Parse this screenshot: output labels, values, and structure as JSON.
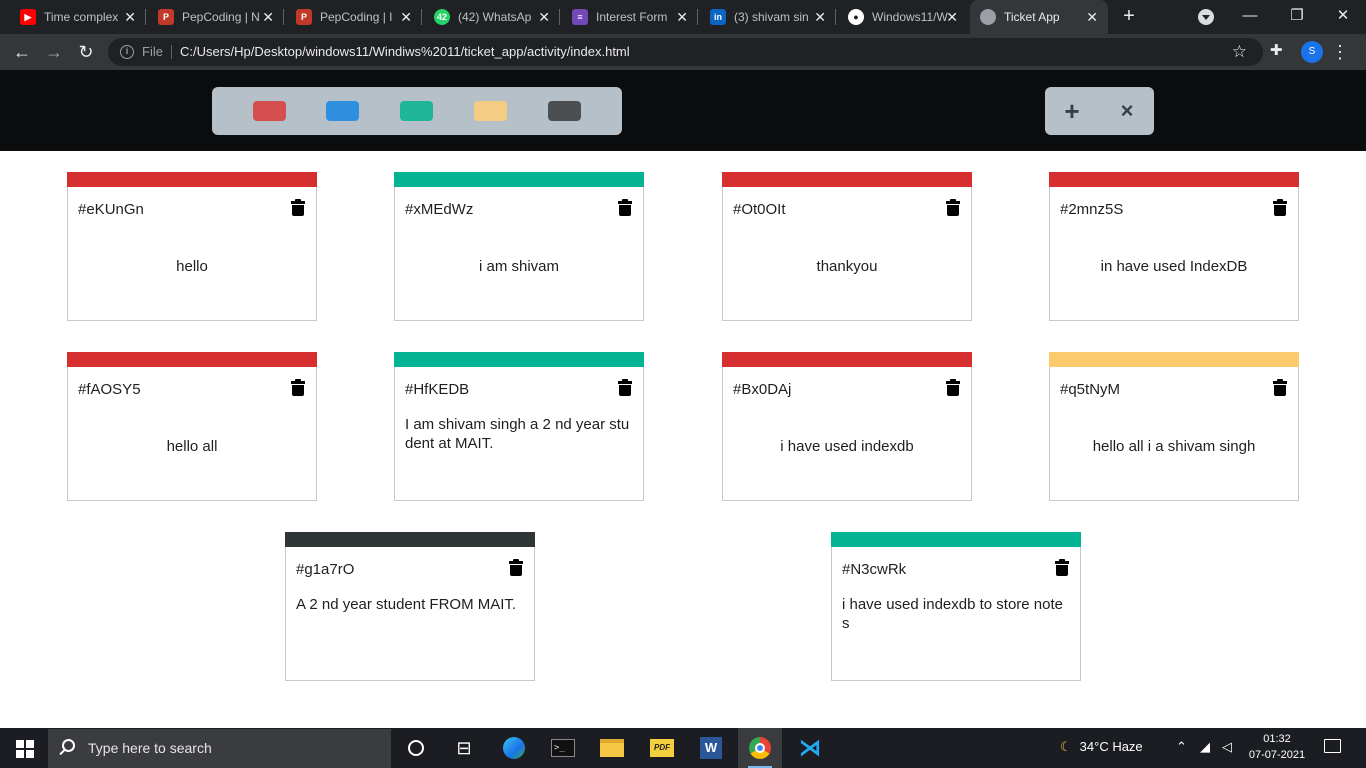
{
  "browser": {
    "tabs": [
      {
        "title": "Time complex",
        "icon": "youtube-icon",
        "color": "#ff0000"
      },
      {
        "title": "PepCoding | N",
        "icon": "pepcoding-icon",
        "color": "#c0392b"
      },
      {
        "title": "PepCoding | I",
        "icon": "pepcoding-icon",
        "color": "#c0392b"
      },
      {
        "title": "(42) WhatsAp",
        "icon": "whatsapp-icon",
        "color": "#25d366",
        "badge": "42"
      },
      {
        "title": "Interest Form",
        "icon": "forms-icon",
        "color": "#7248b9"
      },
      {
        "title": "(3) shivam sin",
        "icon": "linkedin-icon",
        "color": "#0a66c2"
      },
      {
        "title": "Windows11/W",
        "icon": "github-icon",
        "color": "#ffffff"
      },
      {
        "title": "Ticket App",
        "icon": "globe-icon",
        "color": "#9aa0a6",
        "active": true
      }
    ],
    "address": {
      "scheme_label": "File",
      "url": "C:/Users/Hp/Desktop/windows11/Windiws%2011/ticket_app/activity/index.html"
    },
    "profile_initial": "S"
  },
  "app": {
    "palette_colors": [
      "#d54f4f",
      "#2e8fdf",
      "#1db69b",
      "#f5cd82",
      "#4b4f52"
    ],
    "add_label": "+",
    "remove_label": "×"
  },
  "tickets": [
    {
      "id": "#eKUnGn",
      "text": "hello",
      "color": "#d72f2f",
      "align": "center"
    },
    {
      "id": "#xMEdWz",
      "text": "i am shivam",
      "color": "#03b393",
      "align": "center"
    },
    {
      "id": "#Ot0OIt",
      "text": "thankyou",
      "color": "#d72f2f",
      "align": "center"
    },
    {
      "id": "#2mnz5S",
      "text": "in have used IndexDB",
      "color": "#d72f2f",
      "align": "center"
    },
    {
      "id": "#fAOSY5",
      "text": "hello all",
      "color": "#d72f2f",
      "align": "center"
    },
    {
      "id": "#HfKEDB",
      "text": "I am shivam singh a 2 nd year student at MAIT.",
      "color": "#03b393",
      "align": "left"
    },
    {
      "id": "#Bx0DAj",
      "text": "i have used indexdb",
      "color": "#d72f2f",
      "align": "center"
    },
    {
      "id": "#q5tNyM",
      "text": "hello all i a shivam singh",
      "color": "#fbca6c",
      "align": "center"
    },
    {
      "id": "#g1a7rO",
      "text": "A 2 nd year student FROM MAIT.",
      "color": "#2f3437",
      "align": "left"
    },
    {
      "id": "#N3cwRk",
      "text": "i have used indexdb to store notes",
      "color": "#03b393",
      "align": "left"
    }
  ],
  "taskbar": {
    "search_placeholder": "Type here to search",
    "weather": "34°C  Haze",
    "time": "01:32",
    "date": "07-07-2021"
  }
}
